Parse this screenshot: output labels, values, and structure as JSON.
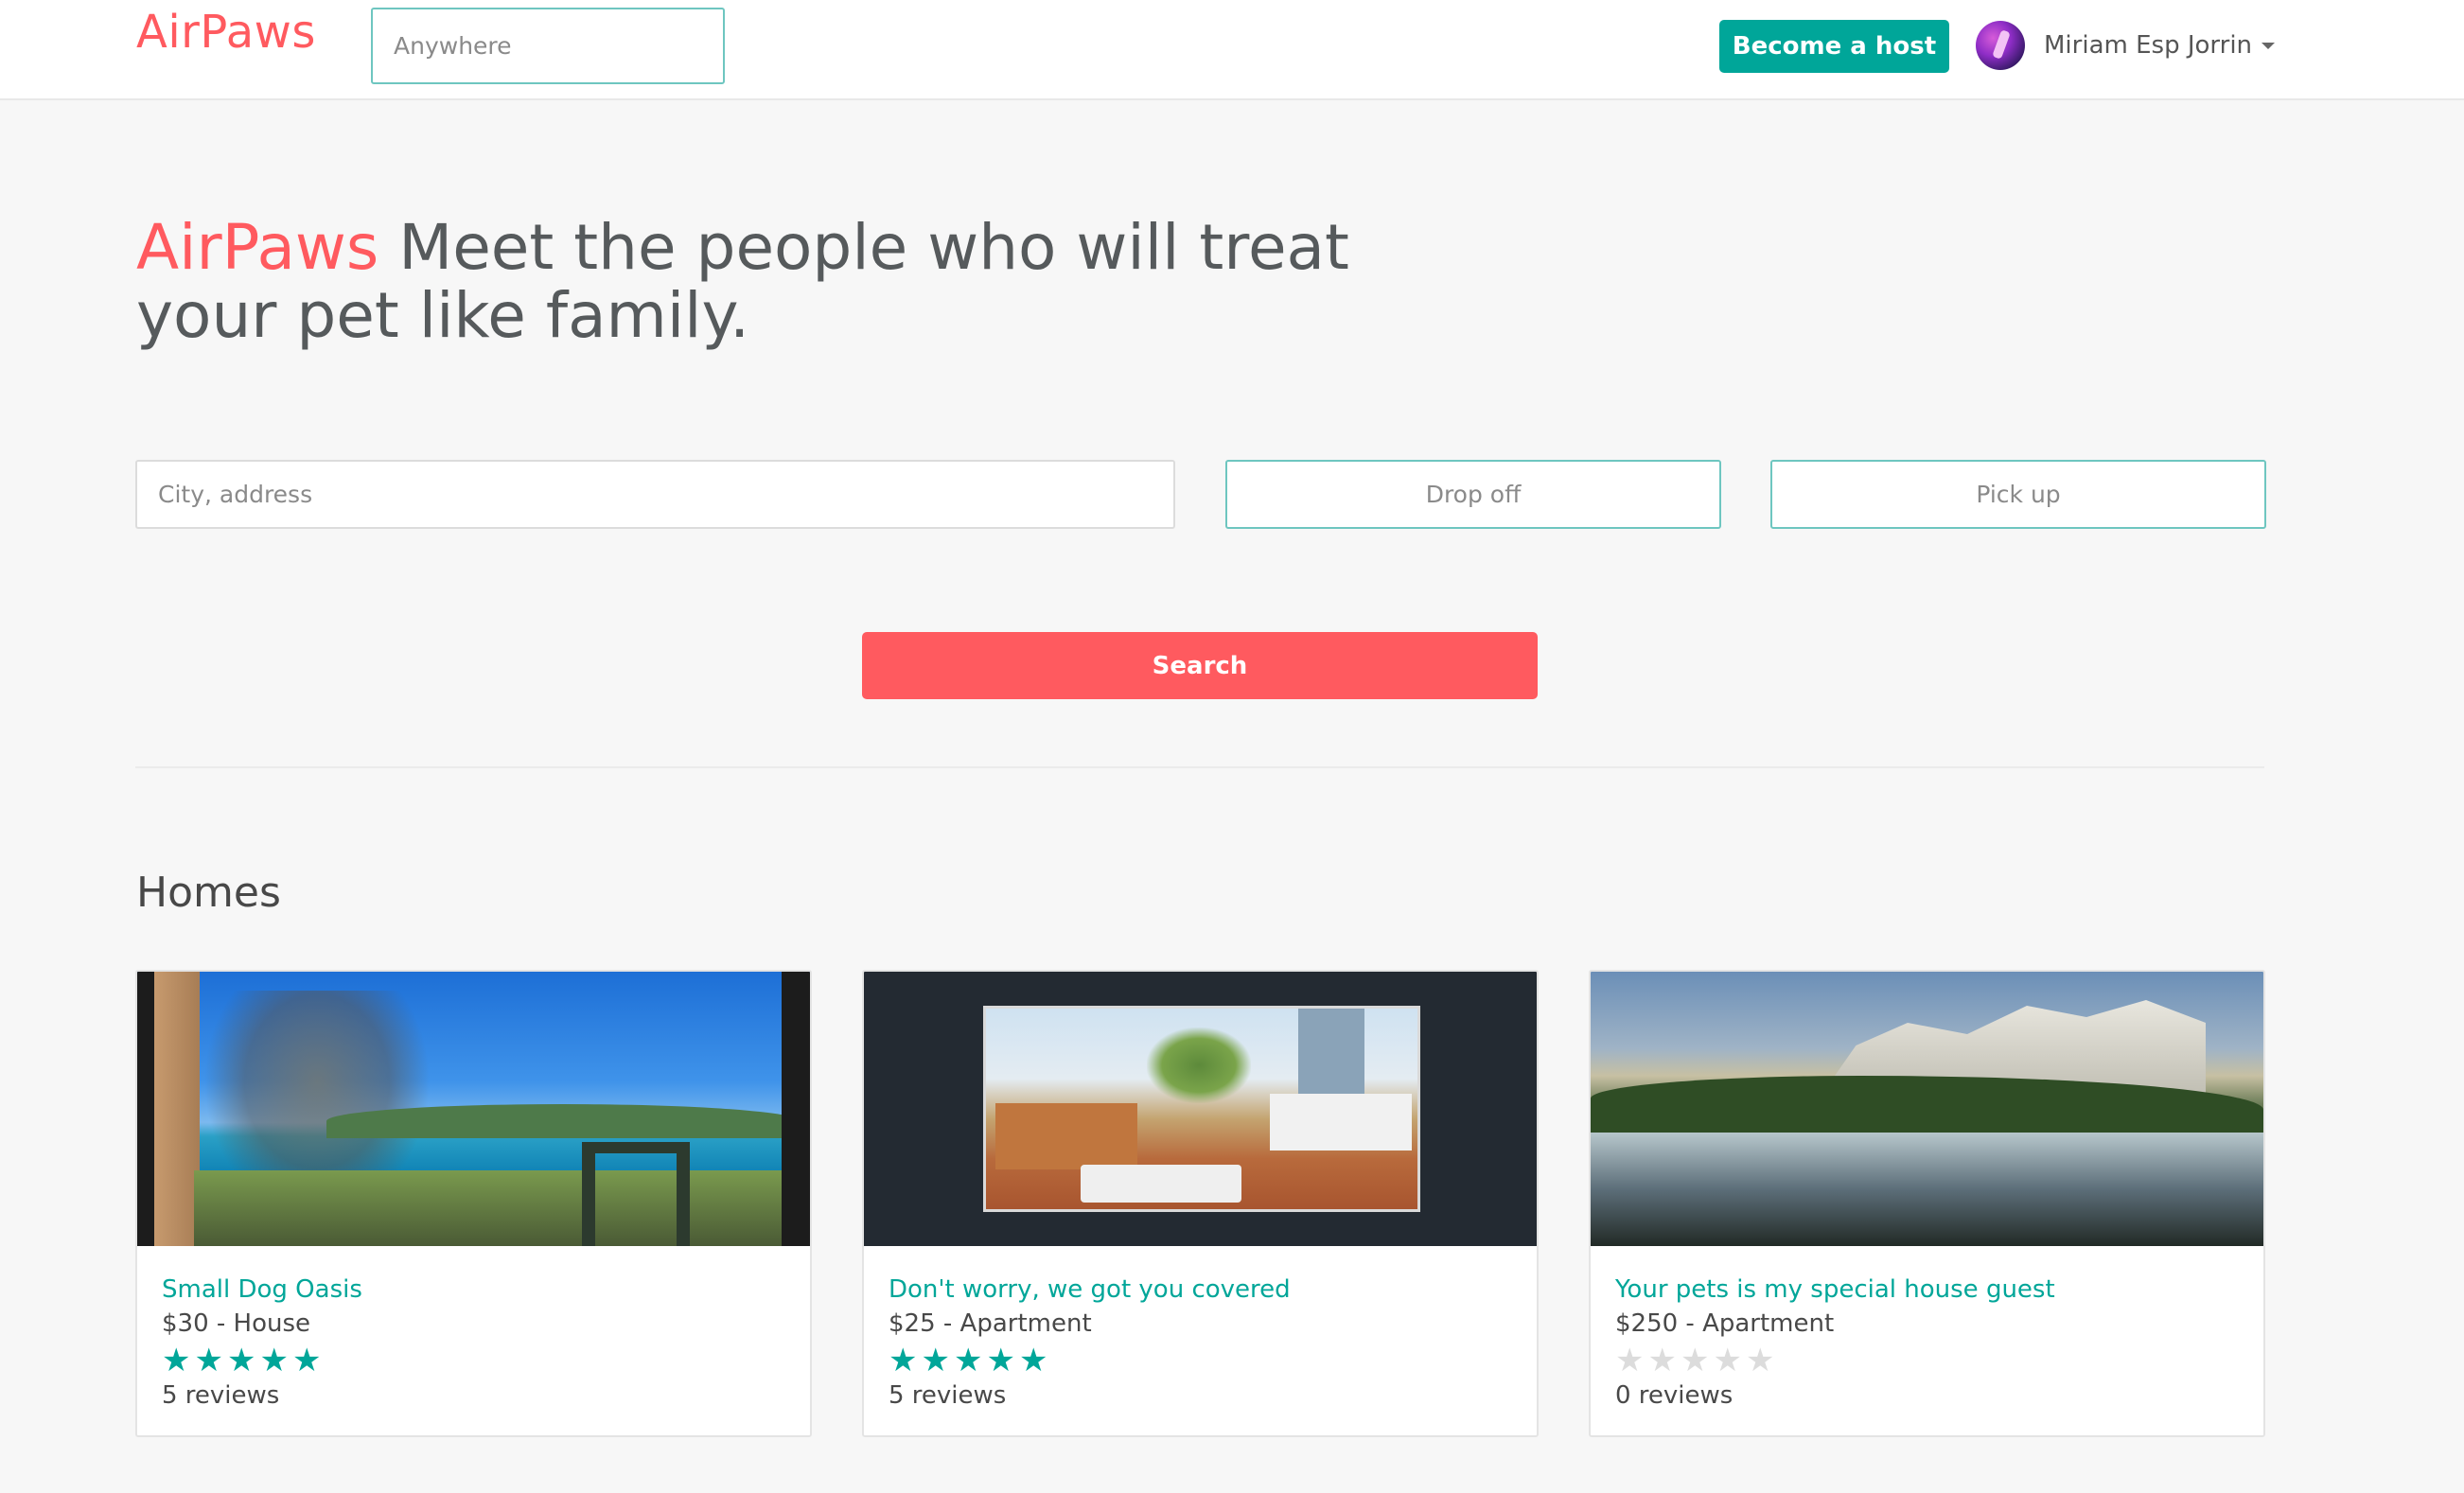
{
  "navbar": {
    "brand": "AirPaws",
    "search_placeholder": "Anywhere",
    "host_button": "Become a host",
    "user_name": "Miriam Esp Jorrin"
  },
  "hero": {
    "brand": "AirPaws",
    "tagline": " Meet the people who will treat your pet like family."
  },
  "search_form": {
    "city_placeholder": "City, address",
    "drop_off_placeholder": "Drop off",
    "pick_up_placeholder": "Pick up",
    "search_button": "Search"
  },
  "homes": {
    "title": "Homes",
    "items": [
      {
        "title": "Small Dog Oasis",
        "price_type": "$30 - House",
        "rating": 5,
        "max_rating": 5,
        "reviews": "5 reviews"
      },
      {
        "title": "Don't worry, we got you covered",
        "price_type": "$25 - Apartment",
        "rating": 5,
        "max_rating": 5,
        "reviews": "5 reviews"
      },
      {
        "title": "Your pets is my special house guest",
        "price_type": "$250 - Apartment",
        "rating": 0,
        "max_rating": 5,
        "reviews": "0 reviews"
      }
    ]
  },
  "colors": {
    "brand": "#ff5a5f",
    "accent": "#00a699",
    "star_off": "#dcdcdc"
  }
}
